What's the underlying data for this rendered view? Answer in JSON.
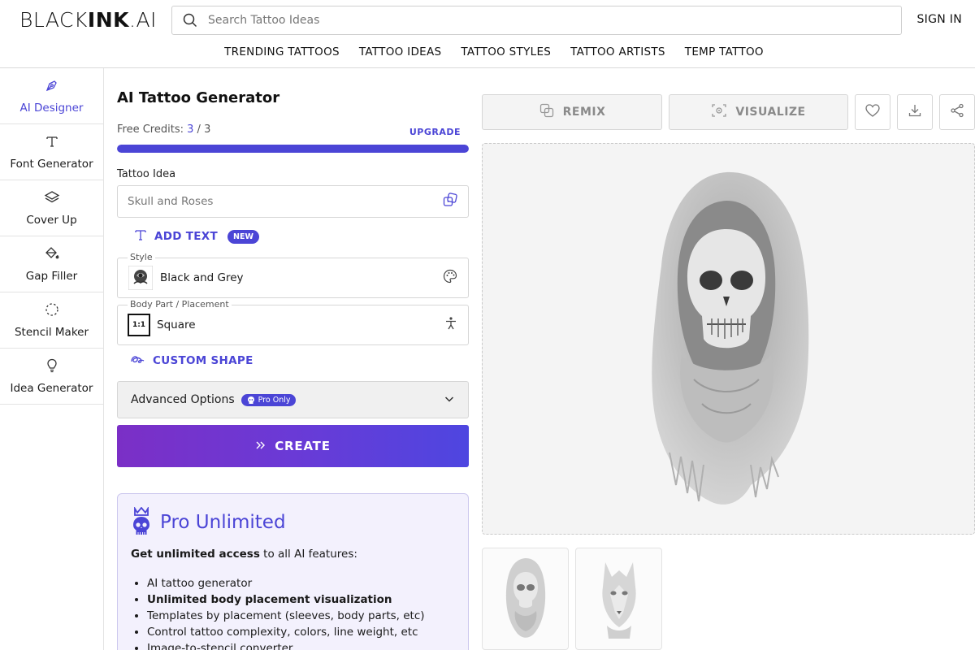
{
  "header": {
    "logo_light": "BLACK",
    "logo_bold": "INK",
    "logo_suffix": ".AI",
    "search_placeholder": "Search Tattoo Ideas",
    "signin": "SIGN IN",
    "nav": [
      "TRENDING TATTOOS",
      "TATTOO IDEAS",
      "TATTOO STYLES",
      "TATTOO ARTISTS",
      "TEMP TATTOO"
    ]
  },
  "sidebar": {
    "items": [
      {
        "label": "AI Designer",
        "icon": "pen-tool-icon",
        "active": true
      },
      {
        "label": "Font Generator",
        "icon": "text-icon"
      },
      {
        "label": "Cover Up",
        "icon": "layers-icon"
      },
      {
        "label": "Gap Filler",
        "icon": "paint-bucket-icon"
      },
      {
        "label": "Stencil Maker",
        "icon": "dashed-circle-icon"
      },
      {
        "label": "Idea Generator",
        "icon": "lightbulb-icon"
      }
    ]
  },
  "form": {
    "title": "AI Tattoo Generator",
    "credits_label": "Free Credits:",
    "credits_used": "3",
    "credits_sep": "/",
    "credits_total": "3",
    "credits_fraction": 1.0,
    "upgrade": "UPGRADE",
    "idea_label": "Tattoo Idea",
    "idea_placeholder": "Skull and Roses",
    "add_text": "ADD TEXT",
    "new_badge": "NEW",
    "style_legend": "Style",
    "style_value": "Black and Grey",
    "placement_legend": "Body Part / Placement",
    "placement_value": "Square",
    "placement_thumb": "1:1",
    "custom_shape": "CUSTOM SHAPE",
    "advanced": "Advanced Options",
    "pro_only": "Pro Only",
    "create": "CREATE"
  },
  "pro_card": {
    "title": "Pro Unlimited",
    "intro_bold": "Get unlimited access",
    "intro_rest": " to all AI features:",
    "features": [
      {
        "text": "AI tattoo generator",
        "bold": false
      },
      {
        "text": "Unlimited body placement visualization",
        "bold": true
      },
      {
        "text": "Templates by placement (sleeves, body parts, etc)",
        "bold": false
      },
      {
        "text": "Control tattoo complexity, colors, line weight, etc",
        "bold": false
      },
      {
        "text": "Image-to-stencil converter",
        "bold": false
      }
    ]
  },
  "actions": {
    "remix": "REMIX",
    "visualize": "VISUALIZE"
  },
  "colors": {
    "accent": "#4b45d6",
    "create_gradient_start": "#7b2fc6",
    "create_gradient_end": "#4e46e0"
  }
}
